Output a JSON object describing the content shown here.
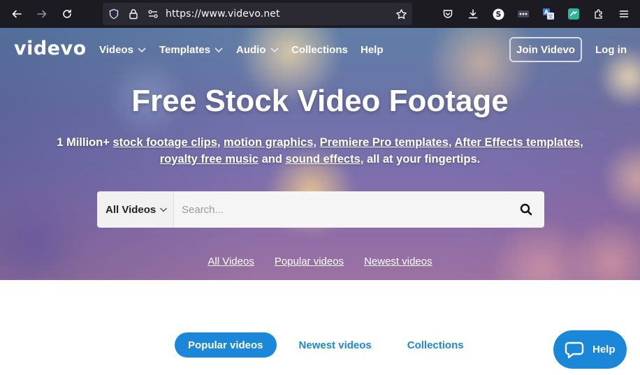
{
  "browser": {
    "url": "https://www.videvo.net"
  },
  "header": {
    "logo": "videvo",
    "nav": {
      "videos": "Videos",
      "templates": "Templates",
      "audio": "Audio",
      "collections": "Collections",
      "help": "Help"
    },
    "join_label": "Join Videvo",
    "login_label": "Log in"
  },
  "hero": {
    "title": "Free Stock Video Footage",
    "sub": {
      "prefix": "1 Million+ ",
      "link1": "stock footage clips",
      "sep1": ", ",
      "link2": "motion graphics",
      "sep2": ", ",
      "link3": "Premiere Pro templates",
      "sep3": ", ",
      "link4": "After Effects templates",
      "sep4": ",",
      "link5": "royalty free music",
      "mid": " and ",
      "link6": "sound effects",
      "suffix": ", all at your fingertips."
    }
  },
  "search": {
    "category": "All Videos",
    "placeholder": "Search..."
  },
  "quick_links": {
    "all": "All Videos",
    "popular": "Popular videos",
    "newest": "Newest videos"
  },
  "content_tabs": {
    "popular": "Popular videos",
    "newest": "Newest videos",
    "collections": "Collections"
  },
  "help_widget": {
    "label": "Help"
  },
  "colors": {
    "accent": "#1a87d9",
    "browser_bg": "#1c1b22"
  },
  "icons": {
    "back": "arrow-left-icon",
    "forward": "arrow-right-icon",
    "reload": "reload-icon",
    "shield": "shield-icon",
    "lock": "lock-icon",
    "permissions": "permissions-icon",
    "bookmark": "star-icon",
    "pocket": "pocket-icon",
    "download": "download-icon",
    "extension_s": "s-extension-icon",
    "extension_dots": "dots-extension-icon",
    "translate": "translate-icon",
    "extension_green": "green-extension-icon",
    "extensions": "puzzle-icon",
    "menu": "hamburger-menu-icon",
    "search": "search-icon",
    "chat": "chat-bubble-icon"
  }
}
